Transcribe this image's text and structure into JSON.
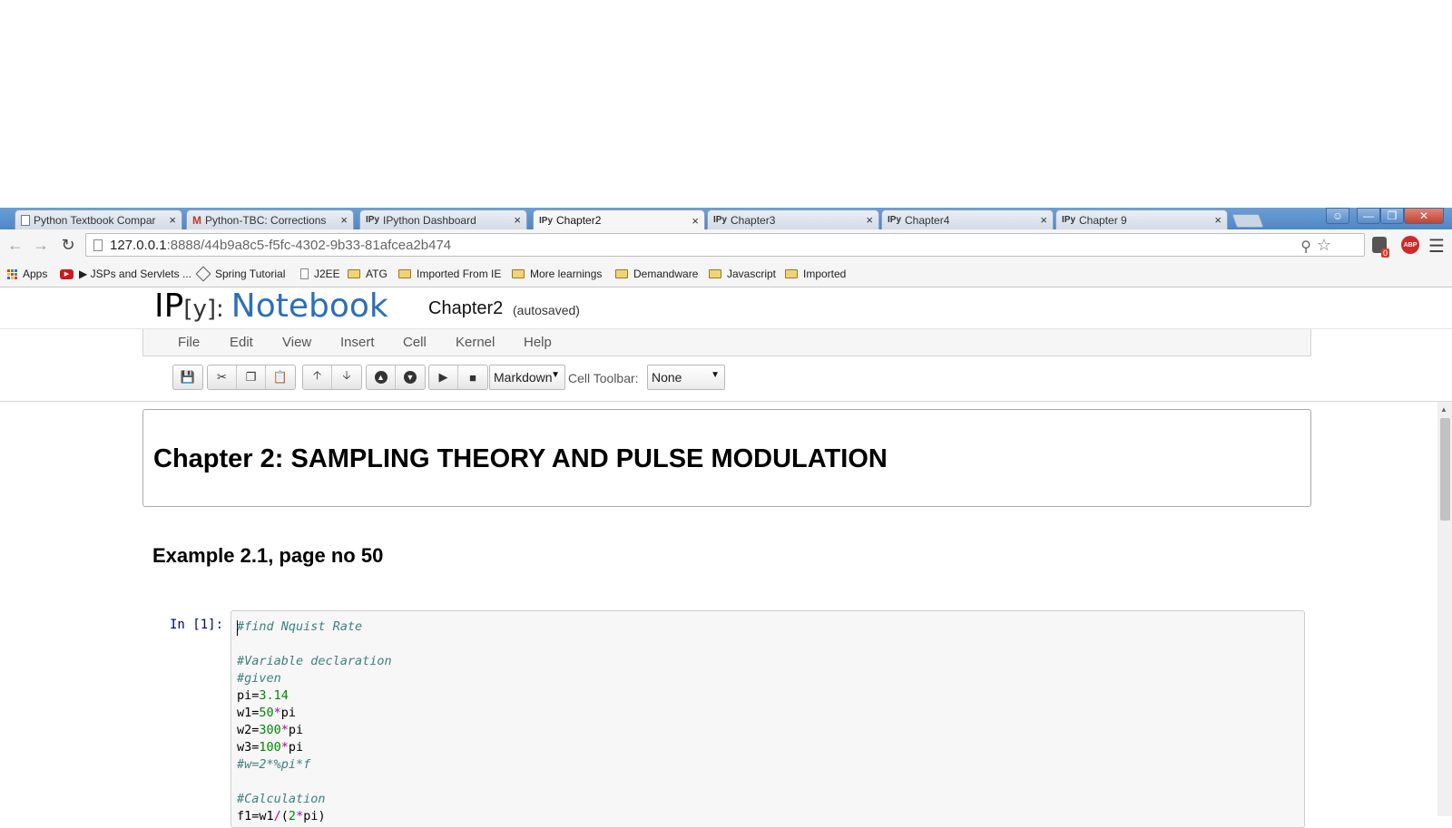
{
  "browser": {
    "tabs": [
      {
        "favicon": "doc",
        "title": "Python Textbook Compar"
      },
      {
        "favicon": "gmail",
        "title": "Python-TBC: Corrections"
      },
      {
        "favicon": "IPy",
        "title": "IPython Dashboard"
      },
      {
        "favicon": "IPy",
        "title": "Chapter2"
      },
      {
        "favicon": "IPy",
        "title": "Chapter3"
      },
      {
        "favicon": "IPy",
        "title": "Chapter4"
      },
      {
        "favicon": "IPy",
        "title": "Chapter 9"
      }
    ],
    "close_glyph": "×",
    "url_host": "127.0.0.1",
    "url_path": ":8888/44b9a8c5-f5fc-4302-9b33-81afcea2b474",
    "bookmarks": [
      {
        "icon": "apps-icon",
        "label": "Apps"
      },
      {
        "icon": "youtube-icon",
        "label": "▶ JSPs and Servlets ..."
      },
      {
        "icon": "spring-icon",
        "label": "Spring Tutorial"
      },
      {
        "icon": "doc-icon",
        "label": "J2EE"
      },
      {
        "icon": "folder-icon",
        "label": "ATG"
      },
      {
        "icon": "folder-icon",
        "label": "Imported From IE"
      },
      {
        "icon": "folder-icon",
        "label": "More learnings"
      },
      {
        "icon": "folder-icon",
        "label": "Demandware"
      },
      {
        "icon": "folder-icon",
        "label": "Javascript"
      },
      {
        "icon": "folder-icon",
        "label": "Imported"
      }
    ],
    "ext_badge": "0",
    "abp_label": "ABP"
  },
  "notebook": {
    "logo_ip": "IP",
    "logo_y": "[y]:",
    "logo_text": "Notebook",
    "name": "Chapter2",
    "autosave": "(autosaved)",
    "menus": [
      "File",
      "Edit",
      "View",
      "Insert",
      "Cell",
      "Kernel",
      "Help"
    ],
    "cell_type": "Markdown",
    "cell_toolbar_label": "Cell Toolbar:",
    "cell_toolbar_value": "None",
    "heading1": "Chapter 2: SAMPLING THEORY AND PULSE MODULATION",
    "heading2": "Example 2.1, page no 50",
    "prompt": "In [1]:"
  },
  "colors": {
    "logo_blue": "#2d6fb6",
    "prompt_blue": "#000080",
    "comment": "#408080",
    "number": "#008800",
    "operator": "#aa00aa"
  }
}
